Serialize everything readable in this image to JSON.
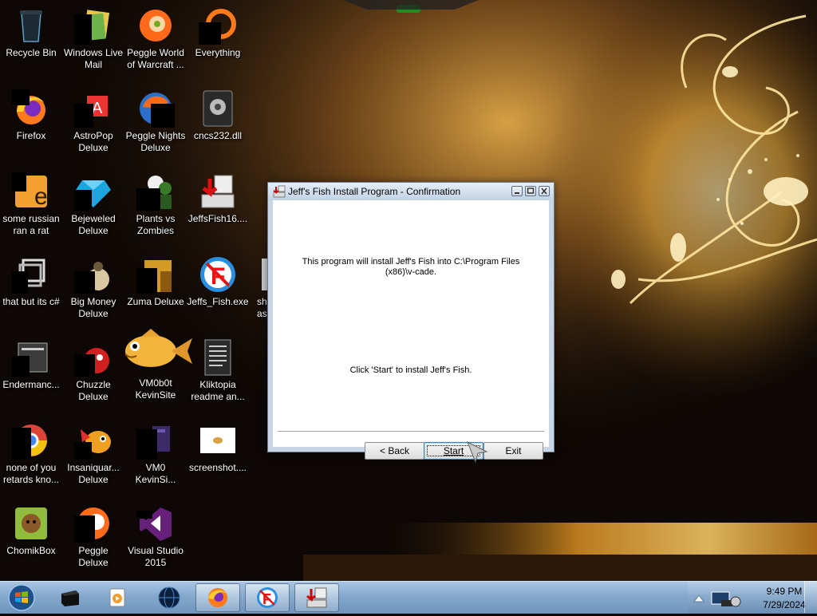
{
  "desktop": {
    "icons": [
      {
        "label": "Recycle Bin",
        "icon": "recycle-bin-icon"
      },
      {
        "label": "Windows Live Mail",
        "icon": "mail-icon"
      },
      {
        "label": "Peggle World of Warcraft ...",
        "icon": "peggle-icon"
      },
      {
        "label": "Everything",
        "icon": "search-tool-icon"
      },
      {
        "label": "Firefox",
        "icon": "firefox-icon"
      },
      {
        "label": "AstroPop Deluxe",
        "icon": "astropop-icon"
      },
      {
        "label": "Peggle Nights Deluxe",
        "icon": "peggle-nights-icon"
      },
      {
        "label": "cncs232.dll",
        "icon": "dll-file-icon"
      },
      {
        "label": "some russian ran a rat",
        "icon": "java-icon"
      },
      {
        "label": "Bejeweled Deluxe",
        "icon": "bejeweled-icon"
      },
      {
        "label": "Plants vs Zombies",
        "icon": "plants-vs-zombies-icon"
      },
      {
        "label": "JeffsFish16....",
        "icon": "installer-icon"
      },
      {
        "label": "that but its c#",
        "icon": "shortcut-icon"
      },
      {
        "label": "Big Money Deluxe",
        "icon": "big-money-icon"
      },
      {
        "label": "Zuma Deluxe",
        "icon": "zuma-icon"
      },
      {
        "label": "Jeffs_Fish.exe",
        "icon": "jeffs-fish-icon"
      },
      {
        "label": "Endermanc...",
        "icon": "document-icon"
      },
      {
        "label": "Chuzzle Deluxe",
        "icon": "chuzzle-icon"
      },
      {
        "label": "VM0b0t KevinSite",
        "icon": "fish-icon"
      },
      {
        "label": "Kliktopia readme an...",
        "icon": "text-file-icon"
      },
      {
        "label": "none of you retards kno...",
        "icon": "chrome-icon"
      },
      {
        "label": "Insaniquar... Deluxe",
        "icon": "insaniquarium-icon"
      },
      {
        "label": "VM0 KevinSi...",
        "icon": "file-icon"
      },
      {
        "label": "screenshot....",
        "icon": "image-file-icon"
      },
      {
        "label": "ChomikBox",
        "icon": "chomikbox-icon"
      },
      {
        "label": "Peggle Deluxe",
        "icon": "peggle-deluxe-icon"
      },
      {
        "label": "Visual Studio 2015",
        "icon": "visual-studio-icon"
      },
      {
        "label": "sh ask",
        "icon": "partial-icon"
      }
    ]
  },
  "dialog": {
    "title": "Jeff's Fish Install Program - Confirmation",
    "message_line1": "This program will install Jeff's Fish into C:\\Program Files",
    "message_line2": "(x86)\\v-cade.",
    "instruction": "Click 'Start' to install Jeff's Fish.",
    "buttons": {
      "back_prefix": "< ",
      "back_label": "Back",
      "start_label": "Start",
      "exit_label": "Exit"
    }
  },
  "taskbar": {
    "pinned": [
      {
        "icon": "cmd-icon",
        "active": false
      },
      {
        "icon": "media-player-icon",
        "active": false
      },
      {
        "icon": "globe-icon",
        "active": false
      },
      {
        "icon": "firefox-icon",
        "active": true
      },
      {
        "icon": "jeffs-fish-icon",
        "active": true
      },
      {
        "icon": "installer-icon",
        "active": true
      }
    ],
    "clock": {
      "time": "9:49 PM",
      "date": "7/29/2024"
    }
  },
  "colors": {
    "wallpaper_glow": "#f3b33a",
    "dialog_frame": "#c9d6e6",
    "taskbar": "#84a8cd",
    "default_button_border": "#3c7fb1"
  }
}
